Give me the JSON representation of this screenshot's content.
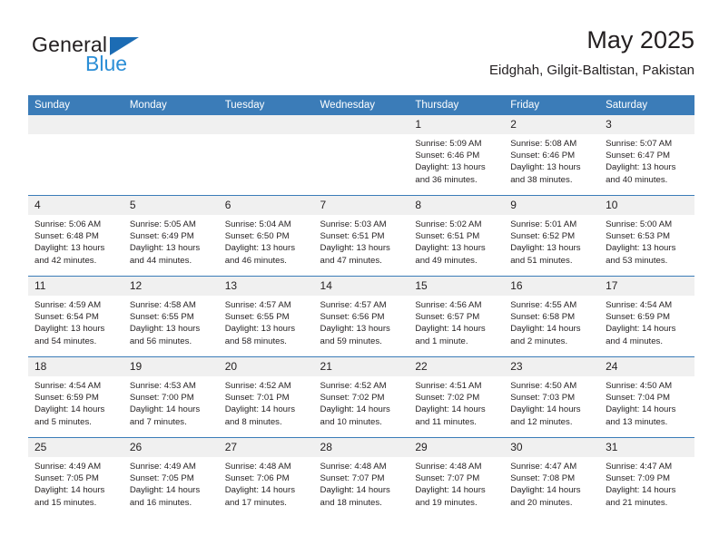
{
  "brand": {
    "name_top": "General",
    "name_bottom": "Blue",
    "accent_color": "#1c6cb4",
    "accent_light": "#2b8ed6"
  },
  "header": {
    "title": "May 2025",
    "subtitle": "Eidghah, Gilgit-Baltistan, Pakistan"
  },
  "theme": {
    "header_row_bg": "#3b7cb8",
    "daynum_bg": "#f0f0f0",
    "text": "#231f20"
  },
  "weekdays": [
    "Sunday",
    "Monday",
    "Tuesday",
    "Wednesday",
    "Thursday",
    "Friday",
    "Saturday"
  ],
  "labels": {
    "sunrise_prefix": "Sunrise:",
    "sunset_prefix": "Sunset:",
    "daylight_prefix": "Daylight:"
  },
  "weeks": [
    [
      {
        "day": "",
        "empty": true
      },
      {
        "day": "",
        "empty": true
      },
      {
        "day": "",
        "empty": true
      },
      {
        "day": "",
        "empty": true
      },
      {
        "day": "1",
        "sunrise": "Sunrise: 5:09 AM",
        "sunset": "Sunset: 6:46 PM",
        "daylight1": "Daylight: 13 hours",
        "daylight2": "and 36 minutes."
      },
      {
        "day": "2",
        "sunrise": "Sunrise: 5:08 AM",
        "sunset": "Sunset: 6:46 PM",
        "daylight1": "Daylight: 13 hours",
        "daylight2": "and 38 minutes."
      },
      {
        "day": "3",
        "sunrise": "Sunrise: 5:07 AM",
        "sunset": "Sunset: 6:47 PM",
        "daylight1": "Daylight: 13 hours",
        "daylight2": "and 40 minutes."
      }
    ],
    [
      {
        "day": "4",
        "sunrise": "Sunrise: 5:06 AM",
        "sunset": "Sunset: 6:48 PM",
        "daylight1": "Daylight: 13 hours",
        "daylight2": "and 42 minutes."
      },
      {
        "day": "5",
        "sunrise": "Sunrise: 5:05 AM",
        "sunset": "Sunset: 6:49 PM",
        "daylight1": "Daylight: 13 hours",
        "daylight2": "and 44 minutes."
      },
      {
        "day": "6",
        "sunrise": "Sunrise: 5:04 AM",
        "sunset": "Sunset: 6:50 PM",
        "daylight1": "Daylight: 13 hours",
        "daylight2": "and 46 minutes."
      },
      {
        "day": "7",
        "sunrise": "Sunrise: 5:03 AM",
        "sunset": "Sunset: 6:51 PM",
        "daylight1": "Daylight: 13 hours",
        "daylight2": "and 47 minutes."
      },
      {
        "day": "8",
        "sunrise": "Sunrise: 5:02 AM",
        "sunset": "Sunset: 6:51 PM",
        "daylight1": "Daylight: 13 hours",
        "daylight2": "and 49 minutes."
      },
      {
        "day": "9",
        "sunrise": "Sunrise: 5:01 AM",
        "sunset": "Sunset: 6:52 PM",
        "daylight1": "Daylight: 13 hours",
        "daylight2": "and 51 minutes."
      },
      {
        "day": "10",
        "sunrise": "Sunrise: 5:00 AM",
        "sunset": "Sunset: 6:53 PM",
        "daylight1": "Daylight: 13 hours",
        "daylight2": "and 53 minutes."
      }
    ],
    [
      {
        "day": "11",
        "sunrise": "Sunrise: 4:59 AM",
        "sunset": "Sunset: 6:54 PM",
        "daylight1": "Daylight: 13 hours",
        "daylight2": "and 54 minutes."
      },
      {
        "day": "12",
        "sunrise": "Sunrise: 4:58 AM",
        "sunset": "Sunset: 6:55 PM",
        "daylight1": "Daylight: 13 hours",
        "daylight2": "and 56 minutes."
      },
      {
        "day": "13",
        "sunrise": "Sunrise: 4:57 AM",
        "sunset": "Sunset: 6:55 PM",
        "daylight1": "Daylight: 13 hours",
        "daylight2": "and 58 minutes."
      },
      {
        "day": "14",
        "sunrise": "Sunrise: 4:57 AM",
        "sunset": "Sunset: 6:56 PM",
        "daylight1": "Daylight: 13 hours",
        "daylight2": "and 59 minutes."
      },
      {
        "day": "15",
        "sunrise": "Sunrise: 4:56 AM",
        "sunset": "Sunset: 6:57 PM",
        "daylight1": "Daylight: 14 hours",
        "daylight2": "and 1 minute."
      },
      {
        "day": "16",
        "sunrise": "Sunrise: 4:55 AM",
        "sunset": "Sunset: 6:58 PM",
        "daylight1": "Daylight: 14 hours",
        "daylight2": "and 2 minutes."
      },
      {
        "day": "17",
        "sunrise": "Sunrise: 4:54 AM",
        "sunset": "Sunset: 6:59 PM",
        "daylight1": "Daylight: 14 hours",
        "daylight2": "and 4 minutes."
      }
    ],
    [
      {
        "day": "18",
        "sunrise": "Sunrise: 4:54 AM",
        "sunset": "Sunset: 6:59 PM",
        "daylight1": "Daylight: 14 hours",
        "daylight2": "and 5 minutes."
      },
      {
        "day": "19",
        "sunrise": "Sunrise: 4:53 AM",
        "sunset": "Sunset: 7:00 PM",
        "daylight1": "Daylight: 14 hours",
        "daylight2": "and 7 minutes."
      },
      {
        "day": "20",
        "sunrise": "Sunrise: 4:52 AM",
        "sunset": "Sunset: 7:01 PM",
        "daylight1": "Daylight: 14 hours",
        "daylight2": "and 8 minutes."
      },
      {
        "day": "21",
        "sunrise": "Sunrise: 4:52 AM",
        "sunset": "Sunset: 7:02 PM",
        "daylight1": "Daylight: 14 hours",
        "daylight2": "and 10 minutes."
      },
      {
        "day": "22",
        "sunrise": "Sunrise: 4:51 AM",
        "sunset": "Sunset: 7:02 PM",
        "daylight1": "Daylight: 14 hours",
        "daylight2": "and 11 minutes."
      },
      {
        "day": "23",
        "sunrise": "Sunrise: 4:50 AM",
        "sunset": "Sunset: 7:03 PM",
        "daylight1": "Daylight: 14 hours",
        "daylight2": "and 12 minutes."
      },
      {
        "day": "24",
        "sunrise": "Sunrise: 4:50 AM",
        "sunset": "Sunset: 7:04 PM",
        "daylight1": "Daylight: 14 hours",
        "daylight2": "and 13 minutes."
      }
    ],
    [
      {
        "day": "25",
        "sunrise": "Sunrise: 4:49 AM",
        "sunset": "Sunset: 7:05 PM",
        "daylight1": "Daylight: 14 hours",
        "daylight2": "and 15 minutes."
      },
      {
        "day": "26",
        "sunrise": "Sunrise: 4:49 AM",
        "sunset": "Sunset: 7:05 PM",
        "daylight1": "Daylight: 14 hours",
        "daylight2": "and 16 minutes."
      },
      {
        "day": "27",
        "sunrise": "Sunrise: 4:48 AM",
        "sunset": "Sunset: 7:06 PM",
        "daylight1": "Daylight: 14 hours",
        "daylight2": "and 17 minutes."
      },
      {
        "day": "28",
        "sunrise": "Sunrise: 4:48 AM",
        "sunset": "Sunset: 7:07 PM",
        "daylight1": "Daylight: 14 hours",
        "daylight2": "and 18 minutes."
      },
      {
        "day": "29",
        "sunrise": "Sunrise: 4:48 AM",
        "sunset": "Sunset: 7:07 PM",
        "daylight1": "Daylight: 14 hours",
        "daylight2": "and 19 minutes."
      },
      {
        "day": "30",
        "sunrise": "Sunrise: 4:47 AM",
        "sunset": "Sunset: 7:08 PM",
        "daylight1": "Daylight: 14 hours",
        "daylight2": "and 20 minutes."
      },
      {
        "day": "31",
        "sunrise": "Sunrise: 4:47 AM",
        "sunset": "Sunset: 7:09 PM",
        "daylight1": "Daylight: 14 hours",
        "daylight2": "and 21 minutes."
      }
    ]
  ]
}
